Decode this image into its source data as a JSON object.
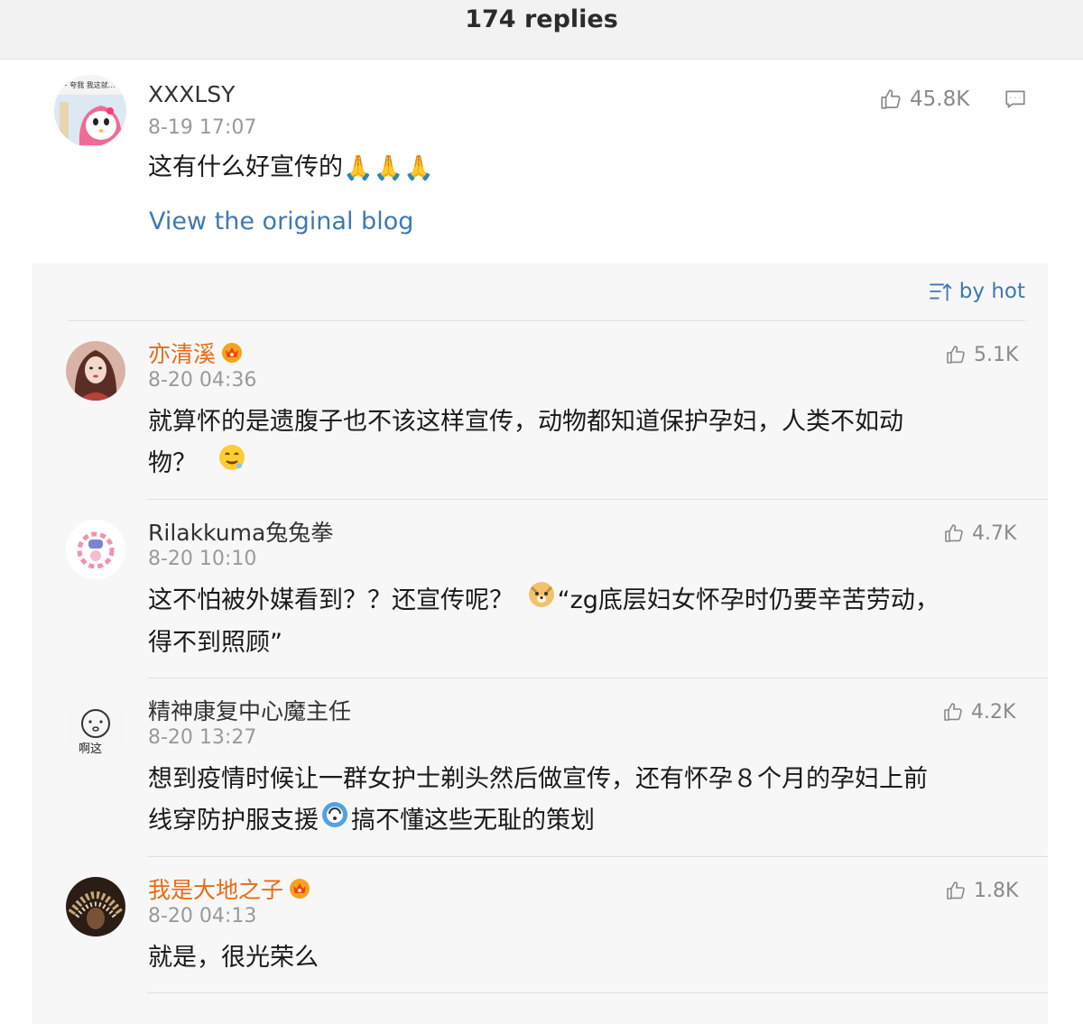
{
  "header": {
    "title": "174 replies"
  },
  "main_comment": {
    "avatar_icon": "cartoon-avatar-icon",
    "username": "XXXLSY",
    "time": "8-19 17:07",
    "content": "这有什么好宣传的",
    "content_emoji": "🙏🙏🙏",
    "likes": "45.8K",
    "view_original_label": "View the original blog"
  },
  "sort": {
    "label": "by hot"
  },
  "replies": [
    {
      "username": "亦清溪",
      "time": "8-20 04:36",
      "content_lines": [
        "就算怀的是遗腹子也不该这样宣传，动物都知道保护孕妇，人类不如动",
        "物？"
      ],
      "likes": "5.1K",
      "vip": true
    },
    {
      "username": "Rilakkuma兔兔拳",
      "time": "8-20 10:10",
      "content_lines": [
        "这不怕被外媒看到？？还宣传呢？",
        "“zg底层妇女怀孕时仍要辛苦劳动，",
        "得不到照顾”"
      ],
      "likes": "4.7K",
      "vip": false
    },
    {
      "username": "精神康复中心魔主任",
      "avatar_text": "啊这",
      "time": "8-20 13:27",
      "content_lines": [
        "想到疫情时候让一群女护士剃头然后做宣传，还有怀孕８个月的孕妇上前",
        "线穿防护服支援",
        "搞不懂这些无耻的策划"
      ],
      "likes": "4.2K",
      "vip": false
    },
    {
      "username": "我是大地之子",
      "time": "8-20 04:13",
      "content_lines": [
        "就是，很光荣么"
      ],
      "likes": "1.8K",
      "vip": true
    }
  ],
  "colors": {
    "accent": "#3f78b3",
    "vip_name": "#ea6a14",
    "meta": "#9a9a9a"
  }
}
